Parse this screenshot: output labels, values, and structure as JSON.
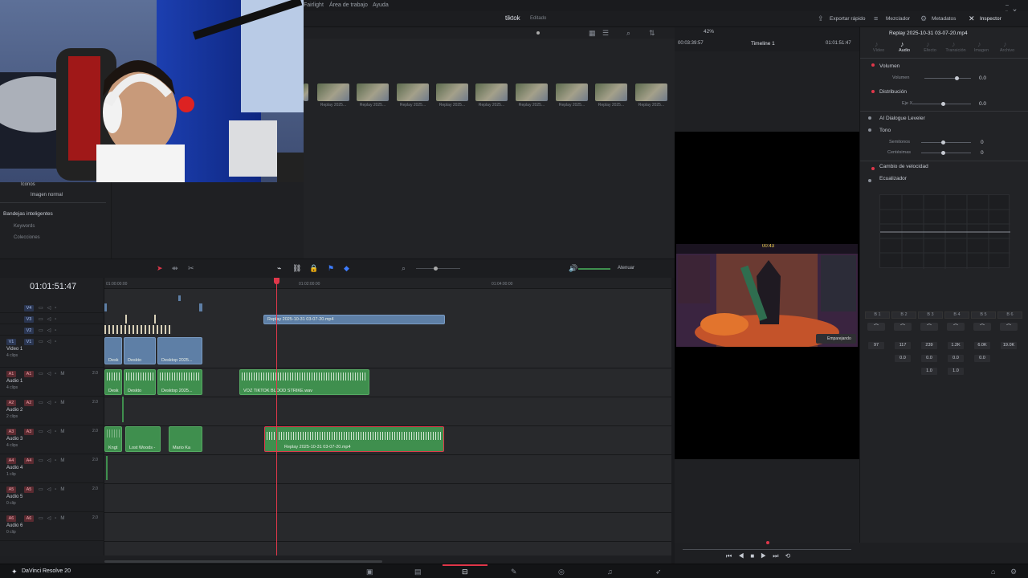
{
  "menu": {
    "fairlight": "Fairlight",
    "workspace": "Área de trabajo",
    "help": "Ayuda"
  },
  "project": {
    "name": "tiktok",
    "status": "Editado"
  },
  "header": {
    "export": "Exportar rápido",
    "mixer": "Mezclador",
    "metadata": "Metadatos",
    "inspector": "Inspector",
    "zoom": "42%",
    "timecode_left": "00:03:39:57",
    "timeline_name": "Timeline 1",
    "timecode_right": "01:01:51:47",
    "clip_title": "Replay 2025-10-31 03-07-20.mp4"
  },
  "media_pool": {
    "thumb_caption": "Replay 2025...",
    "left_items": {
      "icons": "Iconos",
      "normal": "Imagen normal",
      "smart_bins": "Bandejas inteligentes",
      "keywords": "Keywords",
      "collections": "Colecciones"
    }
  },
  "timeline": {
    "timecode": "01:01:51:47",
    "ruler": [
      "01:00:00:00",
      "01:02:00:00",
      "01:04:00:00"
    ],
    "attenuate": "Atenuar",
    "tracks": [
      {
        "tag": "V4"
      },
      {
        "tag": "V3"
      },
      {
        "tag": "V2"
      },
      {
        "tag": "V1",
        "name": "Video 1",
        "sub": "4 clips"
      },
      {
        "tag": "A1",
        "name": "Audio 1",
        "sub": "4 clips",
        "level": "2.0"
      },
      {
        "tag": "A2",
        "name": "Audio 2",
        "sub": "2 clips",
        "level": "2.0"
      },
      {
        "tag": "A3",
        "name": "Audio 3",
        "sub": "4 clips",
        "level": "2.0"
      },
      {
        "tag": "A4",
        "name": "Audio 4",
        "sub": "1 clip",
        "level": "2.0"
      },
      {
        "tag": "A5",
        "name": "Audio 5",
        "sub": "0 clip",
        "level": "2.0"
      },
      {
        "tag": "A6",
        "name": "Audio 6",
        "sub": "0 clip",
        "level": "2.0"
      }
    ],
    "clips": {
      "v3_clip": "Replay 2025-10-31 03-07-20.mp4",
      "v1_a": "Desk",
      "v1_b": "Deskto",
      "v1_c": "Desktop 2025...",
      "a1_a": "Desk",
      "a1_b": "Deskto",
      "a1_c": "Desktop 2025...",
      "a1_voz": "VOZ TIKTOK BLOOD STRIKE.wav",
      "a3_a": "Kngt",
      "a3_b": "Lost Woods -",
      "a3_c": "Mario Ka",
      "a3_replay": "Replay 2025-10-31 03-07-20.mp4"
    }
  },
  "inspector": {
    "tabs": [
      "Vídeo",
      "Audio",
      "Efecto",
      "Transición",
      "Imagen",
      "Archivo"
    ],
    "active_tab": "Audio",
    "volume_section": "Volumen",
    "volume_label": "Volumen",
    "volume_value": "0.0",
    "pan_section": "Distribución",
    "pan_label": "Eje X",
    "pan_value": "0.0",
    "ai_leveler": "AI Dialogue Leveler",
    "pitch_section": "Tono",
    "semitones_label": "Semitonos",
    "semitones_value": "0",
    "cents_label": "Centésimas",
    "cents_value": "0",
    "speed_section": "Cambio de velocidad",
    "eq_section": "Ecualizador",
    "eq_bands": [
      "B 1",
      "B 2",
      "B 3",
      "B 4",
      "B 5",
      "B 6"
    ],
    "eq_freq": [
      "97",
      "117",
      "239",
      "1.2K",
      "6.0K",
      "19.0K"
    ],
    "eq_gain": [
      "0.0",
      "0.0",
      "0.0",
      "0.0"
    ],
    "eq_q": [
      "1.0",
      "1.0"
    ]
  },
  "game_overlay": {
    "time": "00:43",
    "button": "Emparejando"
  },
  "app": {
    "name": "DaVinci Resolve 20"
  },
  "colors": {
    "video_clip": "#5e7fa6",
    "audio_clip": "#3f8f4e",
    "playhead": "#e0374a",
    "accent": "#e0374a"
  }
}
